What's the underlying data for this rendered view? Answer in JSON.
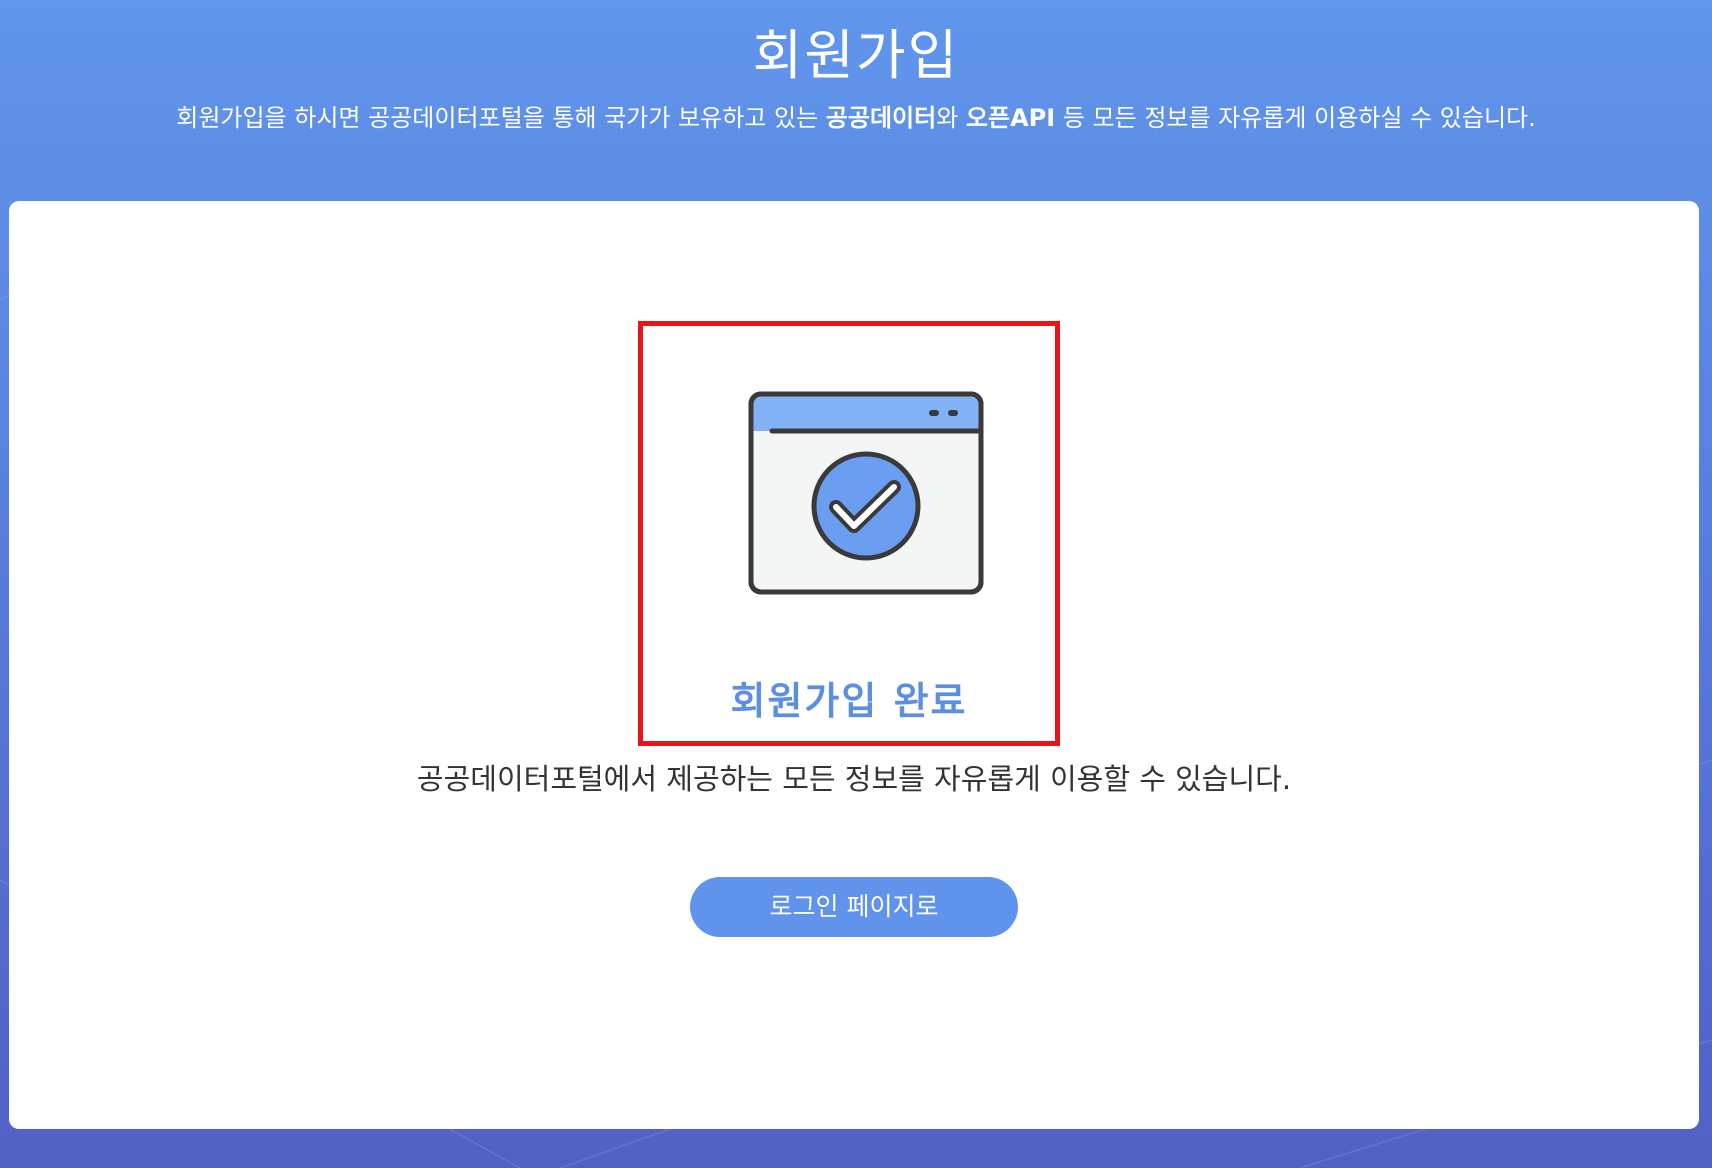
{
  "header": {
    "title": "회원가입",
    "subtitle_prefix": "회원가입을 하시면 공공데이터포털을 통해 국가가 보유하고 있는 ",
    "subtitle_bold1": "공공데이터",
    "subtitle_mid": "와 ",
    "subtitle_bold2": "오픈API",
    "subtitle_suffix": " 등 모든 정보를 자유롭게 이용하실 수 있습니다."
  },
  "complete": {
    "icon": "browser-check-icon",
    "title": "회원가입 완료",
    "description": "공공데이터포털에서 제공하는 모든 정보를 자유롭게 이용할 수 있습니다."
  },
  "actions": {
    "login_label": "로그인 페이지로"
  },
  "colors": {
    "accent": "#5f93ec",
    "title_blue": "#5c8fe4",
    "highlight_red": "#e4161b",
    "background_top": "#6196ec",
    "background_bottom": "#5160c4"
  }
}
